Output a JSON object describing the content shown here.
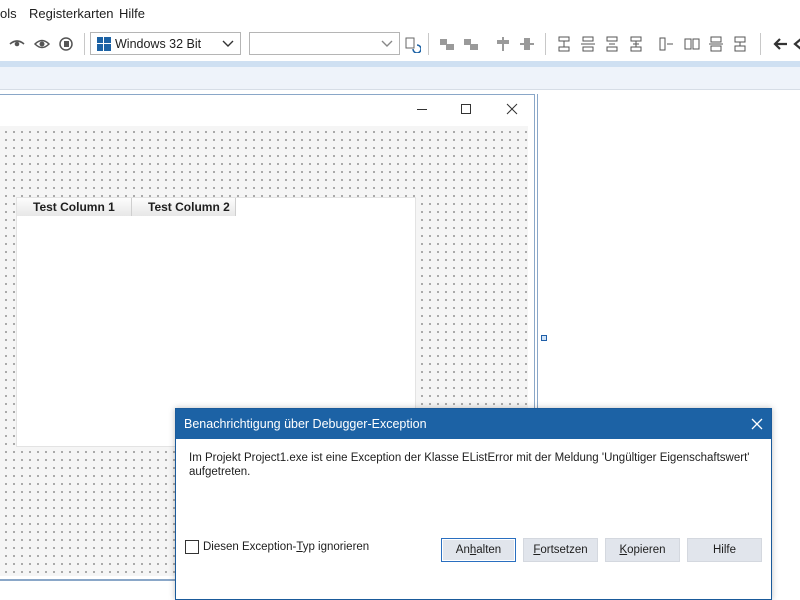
{
  "menu": {
    "items": [
      {
        "label": "ols"
      },
      {
        "label": "Registerkarten"
      },
      {
        "label": "Hilfe"
      }
    ]
  },
  "toolbar": {
    "platform_combo": {
      "value": "Windows 32 Bit"
    },
    "config_combo": {
      "value": ""
    },
    "icons": [
      "eye-closed-icon",
      "eye-icon",
      "step-icon",
      "align-left-icon",
      "align-right-icon",
      "center-horiz-icon",
      "center-vert-icon",
      "space-icon-1",
      "space-icon-2",
      "space-icon-3",
      "space-icon-4",
      "space-icon-5",
      "space-icon-6",
      "space-icon-7",
      "space-icon-8",
      "back-arrow-icon",
      "forward-arrow-icon"
    ]
  },
  "form": {
    "listview": {
      "columns": [
        {
          "label": "Test Column 1"
        },
        {
          "label": "Test Column 2"
        }
      ]
    }
  },
  "dialog": {
    "title": "Benachrichtigung über Debugger-Exception",
    "message": "Im Projekt Project1.exe ist eine Exception der Klasse EListError mit der Meldung 'Ungültiger Eigenschaftswert' aufgetreten.",
    "checkbox": {
      "label_pre": "Diesen Exception-",
      "label_hot": "T",
      "label_post": "yp ignorieren",
      "checked": false
    },
    "buttons": {
      "halt": {
        "pre": "An",
        "hot": "h",
        "post": "alten"
      },
      "continue": {
        "pre": "",
        "hot": "F",
        "post": "ortsetzen"
      },
      "copy": {
        "pre": "",
        "hot": "K",
        "post": "opieren"
      },
      "help": {
        "label": "Hilfe"
      }
    }
  },
  "colors": {
    "dialog_title_bg": "#1c62a5",
    "accent": "#1f5fa8"
  }
}
